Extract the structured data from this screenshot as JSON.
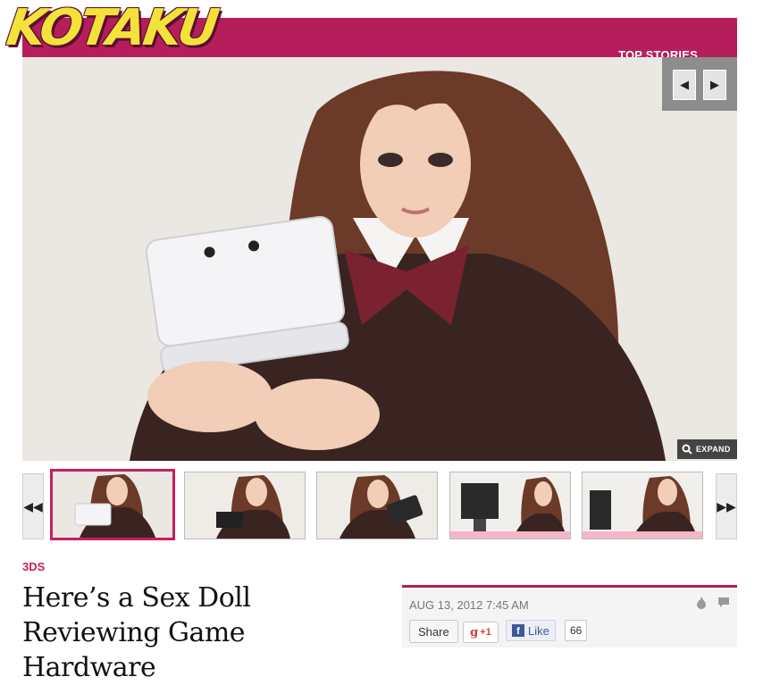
{
  "header": {
    "logo_text": "KOTAKU",
    "top_stories_label": "TOP STORIES",
    "brand_color": "#b51e5b",
    "logo_color": "#f4e23a"
  },
  "hero": {
    "prev_icon": "triangle-left-icon",
    "next_icon": "triangle-right-icon",
    "prev_label": "◀",
    "next_label": "▶",
    "expand_label": "EXPAND",
    "expand_icon": "magnifier-icon"
  },
  "thumbnails": {
    "prev_label": "◀◀",
    "next_label": "▶▶",
    "active_index": 0,
    "count": 5
  },
  "article": {
    "category": "3DS",
    "headline": "Here’s a Sex Doll Reviewing Game Hardware",
    "date": "AUG 13, 2012 7:45 AM",
    "share_label": "Share",
    "gplus_label": "+1",
    "like_label": "Like",
    "like_count": "66",
    "icons": [
      "flame-icon",
      "comment-icon"
    ]
  }
}
